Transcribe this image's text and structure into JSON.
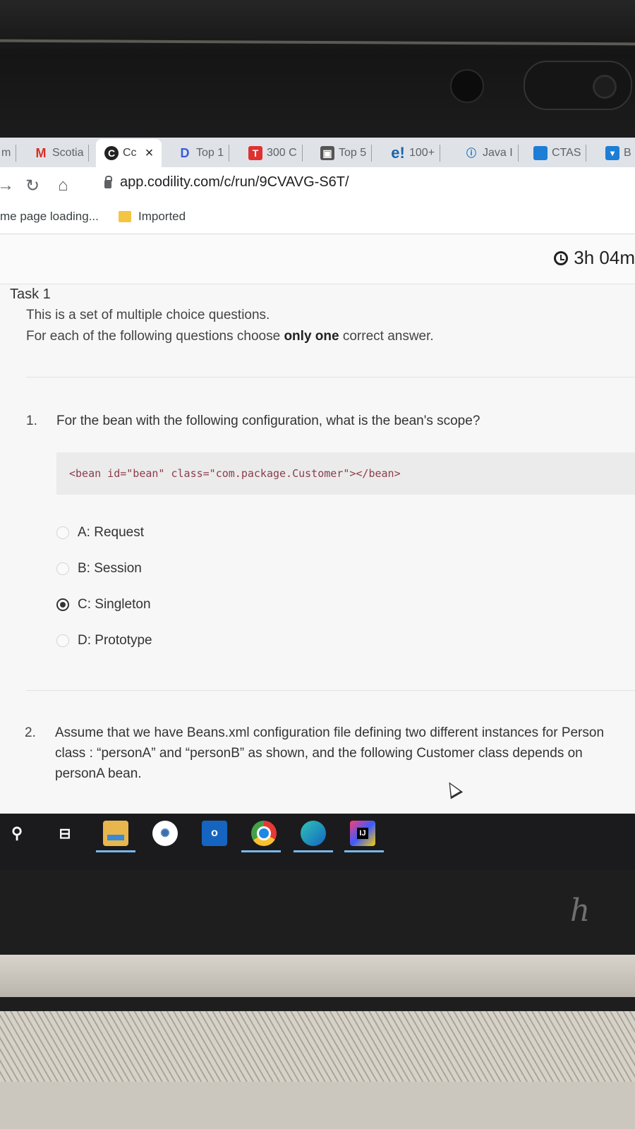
{
  "browser": {
    "tabs": [
      {
        "label": "m",
        "icon": "generic-tab-icon"
      },
      {
        "label": "Scotia",
        "icon": "gmail-icon"
      },
      {
        "label": "Cc",
        "icon": "codility-icon",
        "active": true,
        "close": "×"
      },
      {
        "label": "Top 1",
        "icon": "top-icon"
      },
      {
        "label": "300 C",
        "icon": "t-icon"
      },
      {
        "label": "Top 5",
        "icon": "cube-icon"
      },
      {
        "label": "100+",
        "icon": "e-icon",
        "icon_text": "e!"
      },
      {
        "label": "Java I",
        "icon": "info-icon"
      },
      {
        "label": "CTAS",
        "icon": "square-icon"
      },
      {
        "label": "B",
        "icon": "shield-icon"
      }
    ],
    "url": "app.codility.com/c/run/9CVAVG-S6T/",
    "bookmarks": [
      {
        "label": "me page loading..."
      },
      {
        "label": "Imported",
        "icon": "folder-icon"
      }
    ]
  },
  "page": {
    "timer": "3h 04m",
    "task_title": "Task 1",
    "intro_line1": "This is a set of multiple choice questions.",
    "intro_line2_before": "For each of the following questions choose ",
    "intro_line2_bold": "only one",
    "intro_line2_after": " correct answer.",
    "questions": [
      {
        "number": "1.",
        "text": "For the bean with the following configuration, what is the bean's scope?",
        "code": "<bean id=\"bean\" class=\"com.package.Customer\"></bean>",
        "options": [
          {
            "label": "A: Request",
            "selected": false
          },
          {
            "label": "B: Session",
            "selected": false
          },
          {
            "label": "C: Singleton",
            "selected": true
          },
          {
            "label": "D: Prototype",
            "selected": false
          }
        ]
      },
      {
        "number": "2.",
        "text": "Assume that we have Beans.xml configuration file defining two different instances for Person class : “personA” and “personB” as shown, and the following Customer class depends on personA bean."
      }
    ]
  },
  "taskbar": {
    "items": [
      "search-icon",
      "task-view-icon",
      "file-explorer-icon",
      "app-icon",
      "outlook-icon",
      "chrome-icon",
      "edge-icon",
      "intellij-icon"
    ],
    "outlook_letter": "o",
    "intellij_letters": "IJ"
  },
  "colors": {
    "tabbar_bg": "#dfe3e8",
    "page_bg": "#f7f7f7",
    "code_text": "#8b3d4a",
    "taskbar_bg": "#1b1b1d"
  }
}
